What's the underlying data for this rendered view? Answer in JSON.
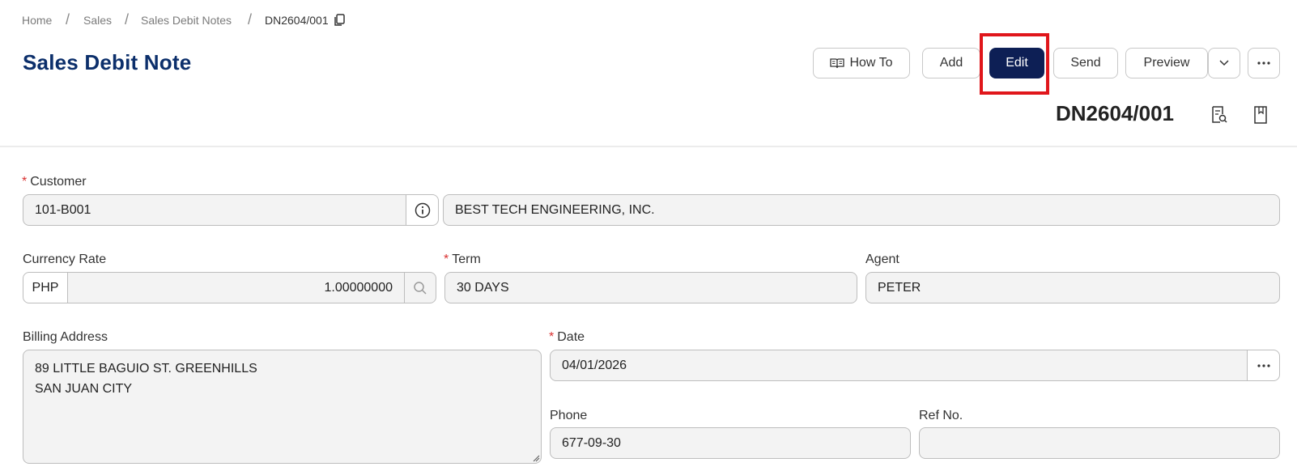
{
  "breadcrumb": {
    "items": [
      "Home",
      "Sales",
      "Sales Debit Notes"
    ],
    "current": "DN2604/001",
    "separator": "/"
  },
  "page": {
    "title": "Sales Debit Note"
  },
  "toolbar": {
    "how_to": "How To",
    "add": "Add",
    "edit": "Edit",
    "send": "Send",
    "preview": "Preview"
  },
  "document": {
    "number": "DN2604/001"
  },
  "form": {
    "customer": {
      "label": "Customer",
      "code": "101-B001",
      "name": "BEST TECH ENGINEERING, INC."
    },
    "currency_rate": {
      "label": "Currency Rate",
      "currency": "PHP",
      "rate": "1.00000000"
    },
    "term": {
      "label": "Term",
      "value": "30 DAYS"
    },
    "agent": {
      "label": "Agent",
      "value": "PETER"
    },
    "billing_address": {
      "label": "Billing Address",
      "value": "89 LITTLE BAGUIO ST. GREENHILLS\nSAN JUAN CITY"
    },
    "date": {
      "label": "Date",
      "value": "04/01/2026"
    },
    "phone": {
      "label": "Phone",
      "value": "677-09-30"
    },
    "ref_no": {
      "label": "Ref No.",
      "value": ""
    }
  },
  "colors": {
    "title": "#0c2f6b",
    "primary_button": "#0d1f55",
    "highlight": "#e0161b",
    "required": "#d93030"
  },
  "icons": [
    "copy-icon",
    "book-icon",
    "chevron-down-icon",
    "more-icon",
    "document-search-icon",
    "bookmark-icon",
    "info-icon",
    "search-icon",
    "ellipsis-icon",
    "resize-handle-icon"
  ]
}
